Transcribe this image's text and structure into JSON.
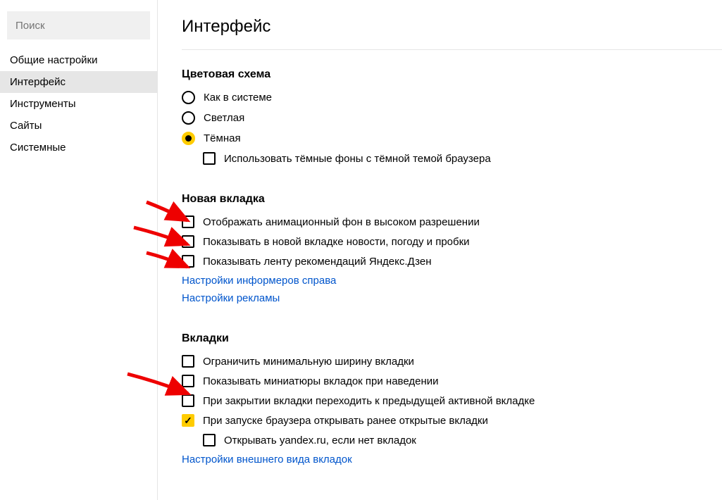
{
  "sidebar": {
    "searchPlaceholder": "Поиск",
    "items": [
      {
        "label": "Общие настройки",
        "active": false
      },
      {
        "label": "Интерфейс",
        "active": true
      },
      {
        "label": "Инструменты",
        "active": false
      },
      {
        "label": "Сайты",
        "active": false
      },
      {
        "label": "Системные",
        "active": false
      }
    ]
  },
  "page": {
    "title": "Интерфейс"
  },
  "sections": {
    "colorScheme": {
      "title": "Цветовая схема",
      "options": [
        {
          "label": "Как в системе",
          "selected": false
        },
        {
          "label": "Светлая",
          "selected": false
        },
        {
          "label": "Тёмная",
          "selected": true
        }
      ],
      "darkBackgroundsLabel": "Использовать тёмные фоны с тёмной темой браузера",
      "darkBackgroundsChecked": false
    },
    "newTab": {
      "title": "Новая вкладка",
      "options": [
        {
          "label": "Отображать анимационный фон в высоком разрешении",
          "checked": false
        },
        {
          "label": "Показывать в новой вкладке новости, погоду и пробки",
          "checked": false
        },
        {
          "label": "Показывать ленту рекомендаций Яндекс.Дзен",
          "checked": false
        }
      ],
      "links": [
        "Настройки информеров справа",
        "Настройки рекламы"
      ]
    },
    "tabs": {
      "title": "Вкладки",
      "options": [
        {
          "label": "Ограничить минимальную ширину вкладки",
          "checked": false
        },
        {
          "label": "Показывать миниатюры вкладок при наведении",
          "checked": false
        },
        {
          "label": "При закрытии вкладки переходить к предыдущей активной вкладке",
          "checked": false
        },
        {
          "label": "При запуске браузера открывать ранее открытые вкладки",
          "checked": true
        }
      ],
      "subOptionLabel": "Открывать yandex.ru, если нет вкладок",
      "subOptionChecked": false,
      "link": "Настройки внешнего вида вкладок"
    }
  }
}
